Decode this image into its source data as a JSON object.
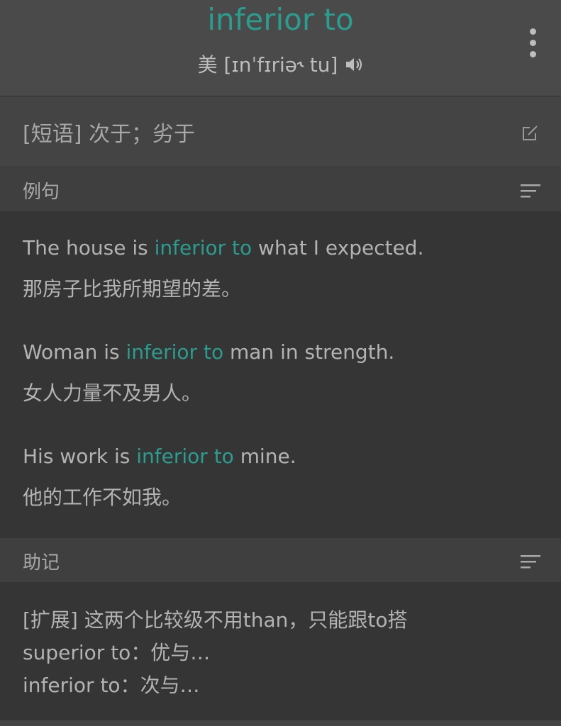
{
  "header": {
    "word": "inferior to",
    "phonetic": "美 [ɪnˈfɪriə˞ tu]"
  },
  "definition": {
    "text": "[短语] 次于；劣于"
  },
  "examples_section": {
    "title": "例句",
    "items": [
      {
        "pre": "The house is ",
        "highlight": "inferior to",
        "post": " what I expected.",
        "cn": "那房子比我所期望的差。"
      },
      {
        "pre": "Woman is ",
        "highlight": "inferior to",
        "post": " man in strength.",
        "cn": "女人力量不及男人。"
      },
      {
        "pre": "His work is ",
        "highlight": "inferior to",
        "post": " mine.",
        "cn": "他的工作不如我。"
      }
    ]
  },
  "memo_section": {
    "title": "助记",
    "lines": [
      "[扩展] 这两个比较级不用than，只能跟to搭",
      "superior to：优与…",
      "inferior to：次与…"
    ]
  },
  "colors": {
    "accent": "#2a9d8f",
    "background": "#353535",
    "header": "#4a4a4a"
  },
  "icons": [
    "speaker-icon",
    "more-vertical-icon",
    "edit-icon",
    "sort-lines-icon"
  ]
}
